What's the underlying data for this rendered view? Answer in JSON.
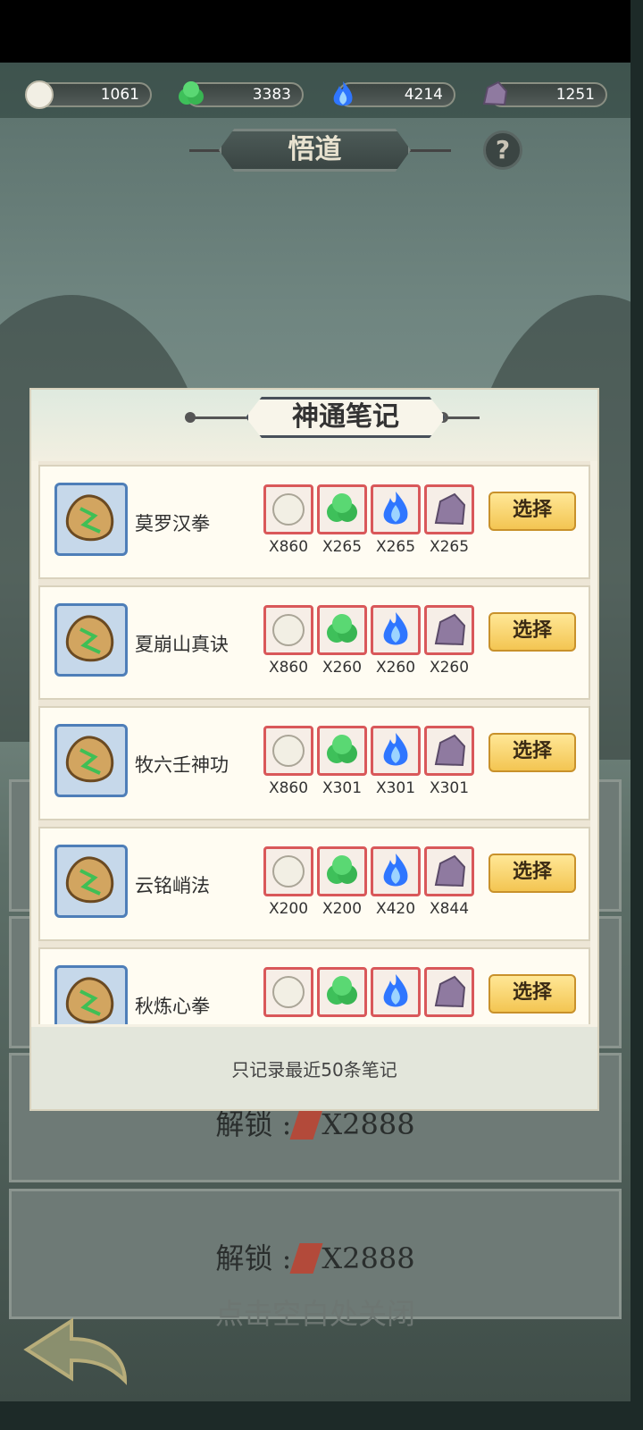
{
  "resources": [
    {
      "icon": "pearl-icon",
      "value": "1061"
    },
    {
      "icon": "green-jade-icon",
      "value": "3383"
    },
    {
      "icon": "blue-flame-icon",
      "value": "4214"
    },
    {
      "icon": "purple-ore-icon",
      "value": "1251"
    }
  ],
  "page": {
    "title": "悟道",
    "help_label": "?"
  },
  "background_cards": [
    {
      "unlock_label": "解锁 :",
      "cost": "X2888"
    },
    {
      "unlock_label": "解锁 :",
      "cost": "X2888"
    }
  ],
  "close_hint": "点击空白处关闭",
  "modal": {
    "title": "神通笔记",
    "footer": "只记录最近50条笔记",
    "select_label": "选择",
    "rows": [
      {
        "name": "莫罗汉拳",
        "costs": [
          "X860",
          "X265",
          "X265",
          "X265"
        ]
      },
      {
        "name": "夏崩山真诀",
        "costs": [
          "X860",
          "X260",
          "X260",
          "X260"
        ]
      },
      {
        "name": "牧六壬神功",
        "costs": [
          "X860",
          "X301",
          "X301",
          "X301"
        ]
      },
      {
        "name": "云铭峭法",
        "costs": [
          "X200",
          "X200",
          "X420",
          "X844"
        ]
      },
      {
        "name": "秋炼心拳",
        "costs": [
          "",
          "",
          "",
          ""
        ]
      }
    ]
  },
  "colors": {
    "accent_button": "#f3c552",
    "cost_border": "#d9585a",
    "icon_frame": "#4e7eb8"
  }
}
